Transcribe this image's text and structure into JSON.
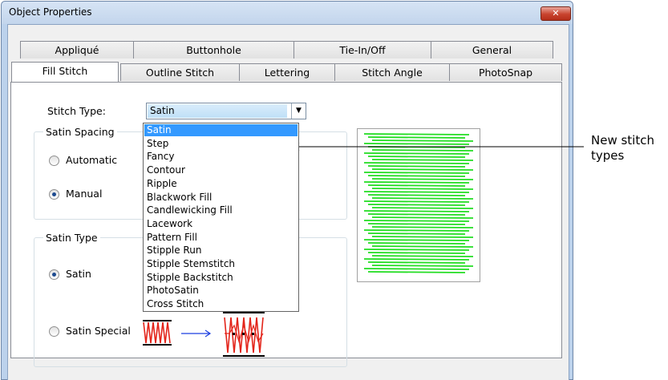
{
  "window": {
    "title": "Object Properties",
    "close": "✕"
  },
  "tabs_row1": [
    {
      "label": "Appliqué"
    },
    {
      "label": "Buttonhole"
    },
    {
      "label": "Tie-In/Off"
    },
    {
      "label": "General"
    }
  ],
  "tabs_row2": [
    {
      "label": "Fill Stitch",
      "active": true
    },
    {
      "label": "Outline Stitch"
    },
    {
      "label": "Lettering"
    },
    {
      "label": "Stitch Angle"
    },
    {
      "label": "PhotoSnap"
    }
  ],
  "stitch_type": {
    "label": "Stitch Type:",
    "value": "Satin"
  },
  "satin_spacing": {
    "group_label": "Satin Spacing",
    "automatic": "Automatic",
    "manual": "Manual",
    "selected": "manual"
  },
  "satin_type": {
    "group_label": "Satin Type",
    "satin": "Satin",
    "satin_special": "Satin Special",
    "selected": "satin"
  },
  "dropdown": {
    "options": [
      "Satin",
      "Step",
      "Fancy",
      "Contour",
      "Ripple",
      "Blackwork Fill",
      "Candlewicking Fill",
      "Lacework",
      "Pattern Fill",
      "Stipple Run",
      "Stipple Stemstitch",
      "Stipple Backstitch",
      "PhotoSatin",
      "Cross Stitch"
    ],
    "selected_index": 0
  },
  "annotation": {
    "line1": "New stitch",
    "line2": "types"
  },
  "colors": {
    "preview_stitch": "#22dd22",
    "satin_special_stitch": "#e3241a",
    "arrow_blue": "#1a3ee0"
  }
}
